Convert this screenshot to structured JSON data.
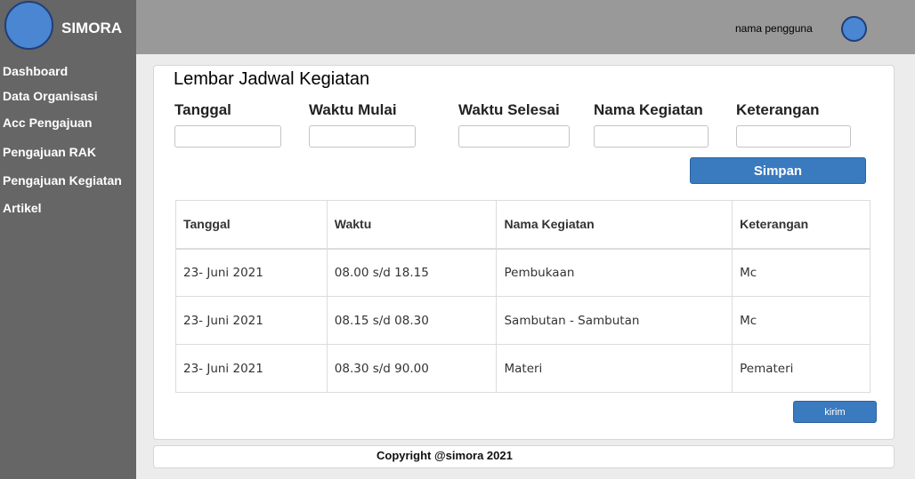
{
  "brand": {
    "name": "SIMORA"
  },
  "sidebar": {
    "items": [
      {
        "label": "Dashboard"
      },
      {
        "label": "Data Organisasi"
      },
      {
        "label": "Acc Pengajuan"
      },
      {
        "label": "Pengajuan RAK"
      },
      {
        "label": "Pengajuan Kegiatan"
      },
      {
        "label": "Artikel"
      }
    ]
  },
  "header": {
    "username": "nama pengguna"
  },
  "form": {
    "title": "Lembar Jadwal Kegiatan",
    "fields": [
      {
        "label": "Tanggal",
        "value": ""
      },
      {
        "label": "Waktu Mulai",
        "value": ""
      },
      {
        "label": "Waktu Selesai",
        "value": ""
      },
      {
        "label": "Nama Kegiatan",
        "value": ""
      },
      {
        "label": "Keterangan",
        "value": ""
      }
    ],
    "save_label": "Simpan"
  },
  "table": {
    "headers": [
      "Tanggal",
      "Waktu",
      "Nama Kegiatan",
      "Keterangan"
    ],
    "rows": [
      [
        "23- Juni 2021",
        "08.00 s/d 18.15",
        "Pembukaan",
        "Mc"
      ],
      [
        "23- Juni 2021",
        "08.15 s/d 08.30",
        "Sambutan - Sambutan",
        "Mc"
      ],
      [
        "23- Juni 2021",
        "08.30 s/d 90.00",
        "Materi",
        "Pemateri"
      ]
    ]
  },
  "send_label": "kirim",
  "footer": {
    "text": "Copyright @simora 2021"
  },
  "colors": {
    "sidebar": "#666666",
    "topbar": "#999999",
    "accent": "#3a7abf",
    "avatar": "#4a86d1"
  }
}
